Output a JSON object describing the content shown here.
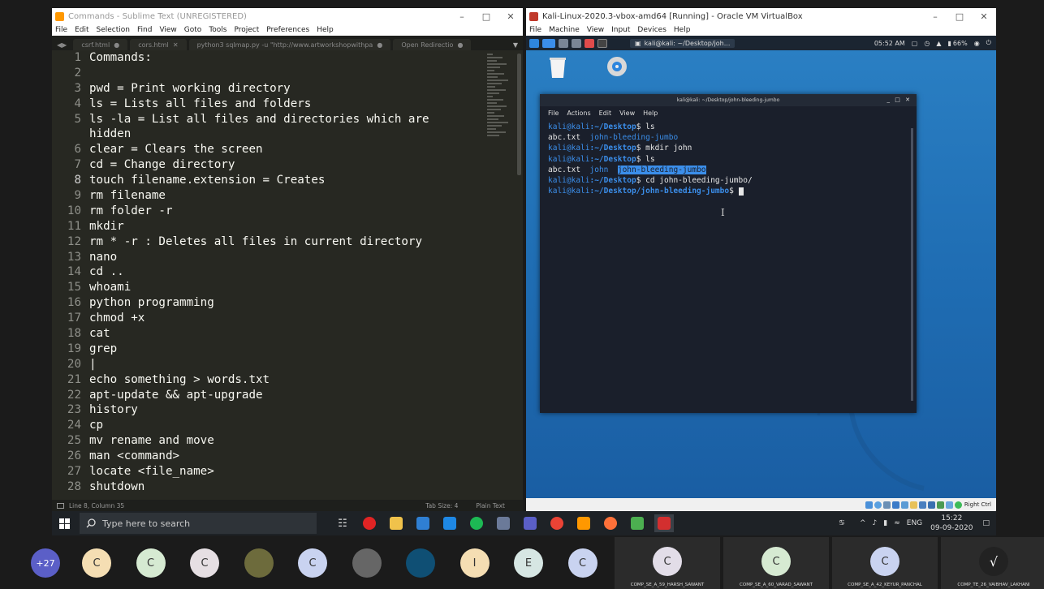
{
  "sublime": {
    "title": "Commands - Sublime Text (UNREGISTERED)",
    "menu": [
      "File",
      "Edit",
      "Selection",
      "Find",
      "View",
      "Goto",
      "Tools",
      "Project",
      "Preferences",
      "Help"
    ],
    "tabs": [
      {
        "label": "csrf.html"
      },
      {
        "label": "cors.html"
      },
      {
        "label": "python3 sqlmap.py -u \"http://www.artworkshopwithpa"
      },
      {
        "label": "Open Redirectio"
      }
    ],
    "lines": [
      {
        "n": "1",
        "t": "Commands:"
      },
      {
        "n": "2",
        "t": ""
      },
      {
        "n": "3",
        "t": "pwd = Print working directory"
      },
      {
        "n": "4",
        "t": "ls = Lists all files and folders"
      },
      {
        "n": "5",
        "t": "ls -la = List all files and directories which are"
      },
      {
        "n": "",
        "t": "hidden"
      },
      {
        "n": "6",
        "t": "clear = Clears the screen"
      },
      {
        "n": "7",
        "t": "cd = Change directory"
      },
      {
        "n": "8",
        "t": "touch filename.extension = Creates"
      },
      {
        "n": "9",
        "t": "rm filename"
      },
      {
        "n": "10",
        "t": "rm folder -r"
      },
      {
        "n": "11",
        "t": "mkdir"
      },
      {
        "n": "12",
        "t": "rm * -r : Deletes all files in current directory"
      },
      {
        "n": "13",
        "t": "nano"
      },
      {
        "n": "14",
        "t": "cd .."
      },
      {
        "n": "15",
        "t": "whoami"
      },
      {
        "n": "16",
        "t": "python programming"
      },
      {
        "n": "17",
        "t": "chmod +x"
      },
      {
        "n": "18",
        "t": "cat"
      },
      {
        "n": "19",
        "t": "grep"
      },
      {
        "n": "20",
        "t": "|"
      },
      {
        "n": "21",
        "t": "echo something > words.txt"
      },
      {
        "n": "22",
        "t": "apt-update && apt-upgrade"
      },
      {
        "n": "23",
        "t": "history"
      },
      {
        "n": "24",
        "t": "cp"
      },
      {
        "n": "25",
        "t": "mv rename and move"
      },
      {
        "n": "26",
        "t": "man <command>"
      },
      {
        "n": "27",
        "t": "locate <file_name>"
      },
      {
        "n": "28",
        "t": "shutdown"
      }
    ],
    "status": {
      "position": "Line 8, Column 35",
      "tab_size": "Tab Size: 4",
      "syntax": "Plain Text"
    }
  },
  "vbox": {
    "title": "Kali-Linux-2020.3-vbox-amd64 [Running] - Oracle VM VirtualBox",
    "menu": [
      "File",
      "Machine",
      "View",
      "Input",
      "Devices",
      "Help"
    ],
    "kali_panel": {
      "task": "kali@kali: ~/Desktop/joh...",
      "time": "05:52 AM",
      "battery": "66%"
    },
    "terminal": {
      "title": "kali@kali: ~/Desktop/john-bleeding-jumbo",
      "menu": [
        "File",
        "Actions",
        "Edit",
        "View",
        "Help"
      ],
      "l1_user": "kali@kali",
      "l1_path": ":~/Desktop",
      "l1_cmd": "$ ls",
      "l2_file": "abc.txt",
      "l2_dir": "john-bleeding-jumbo",
      "l3_user": "kali@kali",
      "l3_path": ":~/Desktop",
      "l3_cmd": "$ mkdir john",
      "l4_user": "kali@kali",
      "l4_path": ":~/Desktop",
      "l4_cmd": "$ ls",
      "l5_file": "abc.txt",
      "l5_dir1": "john",
      "l5_dir2": "john-bleeding-jumbo",
      "l6_user": "kali@kali",
      "l6_path": ":~/Desktop",
      "l6_cmd": "$ cd john-bleeding-jumbo/",
      "l7_user": "kali@kali",
      "l7_path": ":~/Desktop/john-bleeding-jumbo",
      "l7_cmd": "$"
    },
    "status_right": "Right Ctrl"
  },
  "taskbar": {
    "search_placeholder": "Type here to search",
    "lang": "ENG",
    "time": "15:22",
    "date": "09-09-2020"
  },
  "meeting": {
    "more_count": "+27",
    "avatars": [
      {
        "letter": "C",
        "color": "#f5deb3"
      },
      {
        "letter": "C",
        "color": "#d6ead2"
      },
      {
        "letter": "C",
        "color": "#e6dfe3"
      },
      {
        "letter": "",
        "color": "#6d6b3c"
      },
      {
        "letter": "C",
        "color": "#c9d3f0"
      },
      {
        "letter": "",
        "color": "#666666"
      },
      {
        "letter": "",
        "color": "#0f4f74"
      },
      {
        "letter": "I",
        "color": "#f5deb3"
      },
      {
        "letter": "E",
        "color": "#d6e6e3"
      },
      {
        "letter": "C",
        "color": "#c9d3f0"
      }
    ],
    "tiles": [
      {
        "letter": "C",
        "color": "#e2dde8",
        "name": "COMP_SE_A_59_HARSH_SAWANT"
      },
      {
        "letter": "C",
        "color": "#d6ead2",
        "name": "COMP_SE_A_60_VARAD_SAWANT"
      },
      {
        "letter": "C",
        "color": "#c9d3f0",
        "name": "COMP_SE_A_42_KEYUR_PANCHAL"
      },
      {
        "letter": "",
        "color": "#222222",
        "name": "COMP_TE_26_VAIBHAV_LAKHANI"
      }
    ]
  }
}
